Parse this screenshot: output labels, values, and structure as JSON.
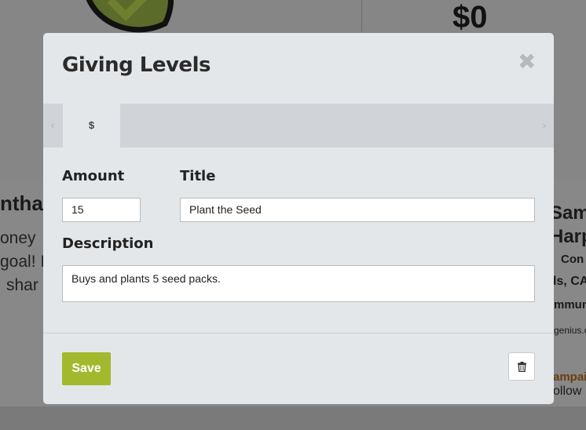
{
  "background": {
    "amount": "$0",
    "name_fragment": "ntha",
    "lines": [
      "oney",
      "goal! I",
      "shar"
    ],
    "right_lines": [
      "Sama",
      "Harp",
      "Con",
      "ls, CA",
      "mmun",
      "genius.c",
      "ampai",
      "ollow"
    ]
  },
  "modal": {
    "title": "Giving Levels",
    "close_label": "✖",
    "tabs": [
      {
        "label": "$"
      }
    ],
    "prev_label": "‹",
    "next_label": "›",
    "amount": {
      "label": "Amount",
      "value": "15"
    },
    "title_field": {
      "label": "Title",
      "value": "Plant the Seed"
    },
    "description": {
      "label": "Description",
      "value": "Buys and plants 5 seed packs."
    },
    "save_label": "Save"
  }
}
